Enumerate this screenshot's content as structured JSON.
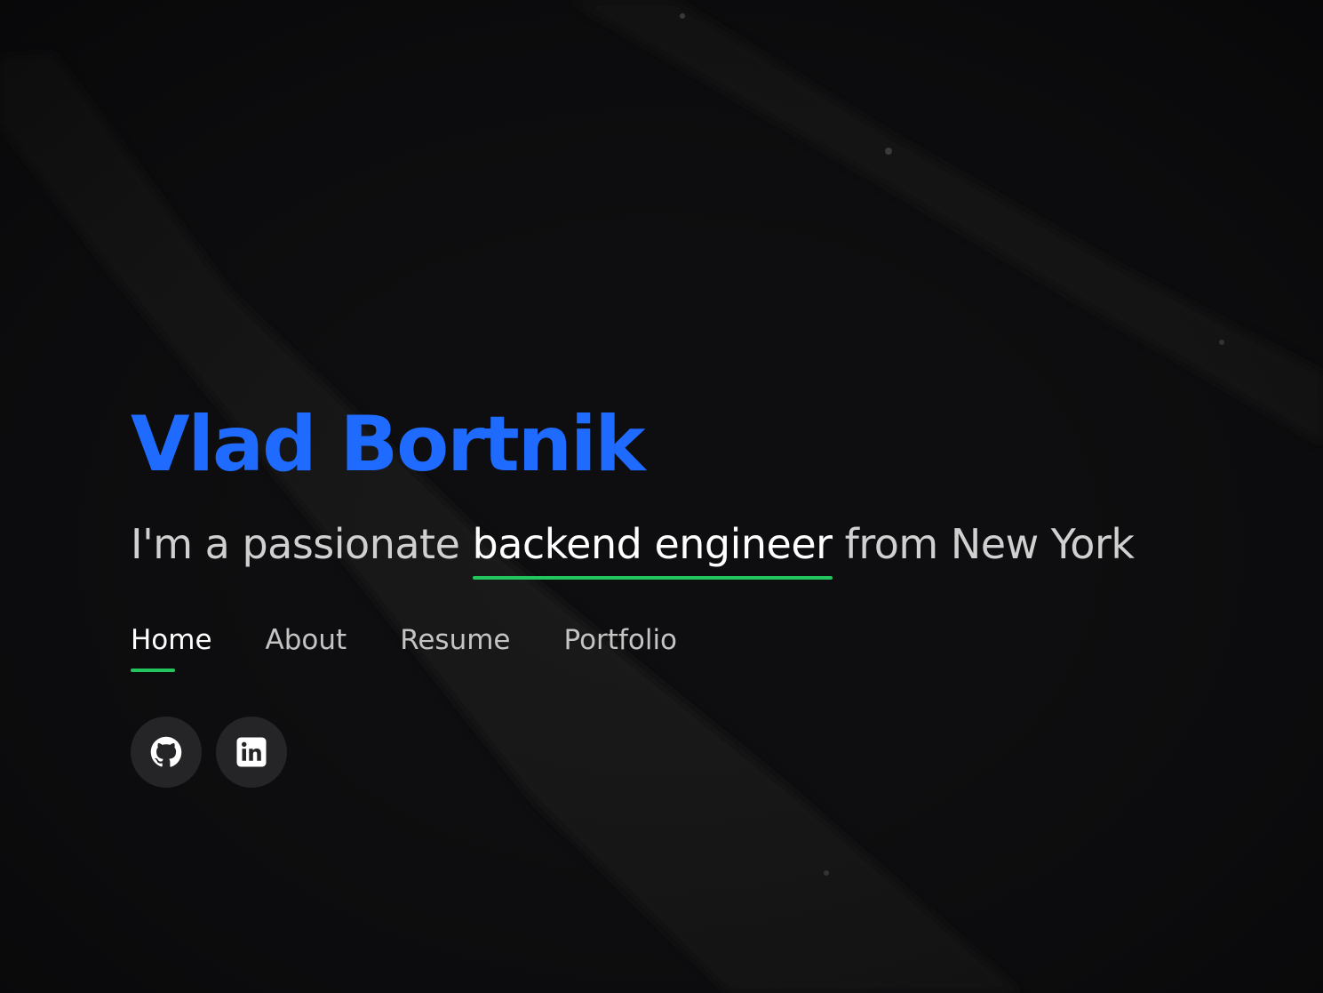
{
  "hero": {
    "name": "Vlad Bortnik",
    "tagline": {
      "prefix": "I'm a passionate ",
      "highlight": "backend engineer",
      "suffix": " from New York"
    }
  },
  "nav": {
    "items": [
      {
        "label": "Home",
        "active": true
      },
      {
        "label": "About",
        "active": false
      },
      {
        "label": "Resume",
        "active": false
      },
      {
        "label": "Portfolio",
        "active": false
      }
    ]
  },
  "social": {
    "items": [
      {
        "icon": "github-icon"
      },
      {
        "icon": "linkedin-icon"
      }
    ]
  },
  "colors": {
    "accent": "#1f6bff",
    "underline": "#22c55e",
    "background": "#0d0d0f",
    "button_bg": "#252527"
  }
}
